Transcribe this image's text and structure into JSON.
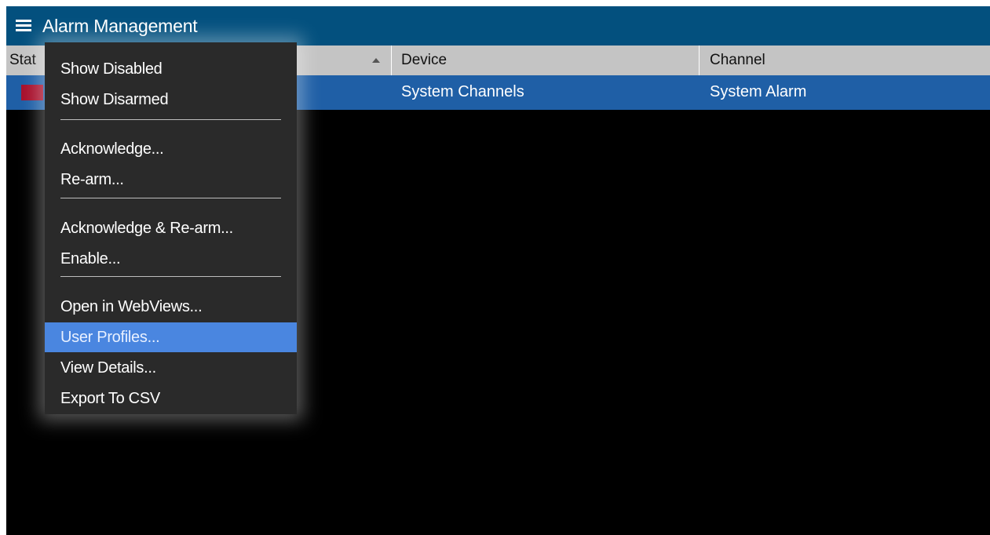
{
  "app": {
    "title": "Alarm Management",
    "menu_icon": "hamburger-icon"
  },
  "grid": {
    "columns": [
      {
        "label": "Stat",
        "sorted": false
      },
      {
        "label": "Device",
        "sorted": true,
        "sort_direction": "ascending"
      },
      {
        "label": "Channel",
        "sorted": false
      }
    ],
    "rows": [
      {
        "status_color": "#a8102c",
        "device": "System Channels",
        "channel": "System Alarm",
        "selected": true
      }
    ]
  },
  "context_menu": {
    "groups": [
      [
        {
          "label": "Show Disabled"
        },
        {
          "label": "Show Disarmed"
        }
      ],
      [
        {
          "label": "Acknowledge..."
        },
        {
          "label": "Re-arm..."
        }
      ],
      [
        {
          "label": "Acknowledge & Re-arm..."
        },
        {
          "label": "Enable..."
        }
      ],
      [
        {
          "label": "Open in WebViews..."
        },
        {
          "label": "User Profiles...",
          "highlighted": true
        },
        {
          "label": "View Details..."
        },
        {
          "label": "Export To CSV"
        }
      ]
    ]
  },
  "colors": {
    "titlebar": "#03507e",
    "header": "#c4c4c4",
    "selected_row": "#1f5fa6",
    "menu_bg": "#2a2a2a",
    "menu_highlight": "#4a86e0",
    "background": "#000000"
  }
}
